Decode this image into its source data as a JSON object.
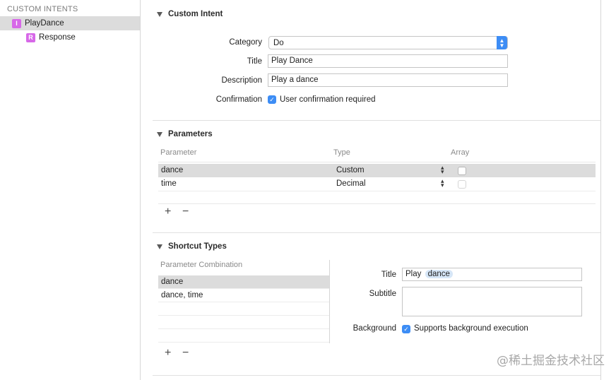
{
  "sidebar": {
    "header": "CUSTOM INTENTS",
    "items": [
      {
        "badge": "I",
        "label": "PlayDance"
      },
      {
        "badge": "R",
        "label": "Response"
      }
    ]
  },
  "custom_intent": {
    "title": "Custom Intent",
    "category_label": "Category",
    "category_value": "Do",
    "title_label": "Title",
    "title_value": "Play Dance",
    "description_label": "Description",
    "description_value": "Play a dance",
    "confirmation_label": "Confirmation",
    "confirmation_text": "User confirmation required"
  },
  "parameters": {
    "title": "Parameters",
    "columns": {
      "parameter": "Parameter",
      "type": "Type",
      "array": "Array"
    },
    "rows": [
      {
        "name": "dance",
        "type": "Custom"
      },
      {
        "name": "time",
        "type": "Decimal"
      }
    ],
    "add": "+",
    "remove": "−"
  },
  "shortcut_types": {
    "title": "Shortcut Types",
    "combo_header": "Parameter Combination",
    "combos": [
      "dance",
      "dance, time"
    ],
    "title_label": "Title",
    "title_prefix": "Play",
    "title_token": "dance",
    "subtitle_label": "Subtitle",
    "background_label": "Background",
    "background_text": "Supports background execution",
    "add": "+",
    "remove": "−"
  },
  "watermark": "@稀土掘金技术社区",
  "colors": {
    "accent": "#3d8df5",
    "badge": "#d768e8",
    "selection": "#dcdcdc",
    "token": "#d6e6f7"
  }
}
